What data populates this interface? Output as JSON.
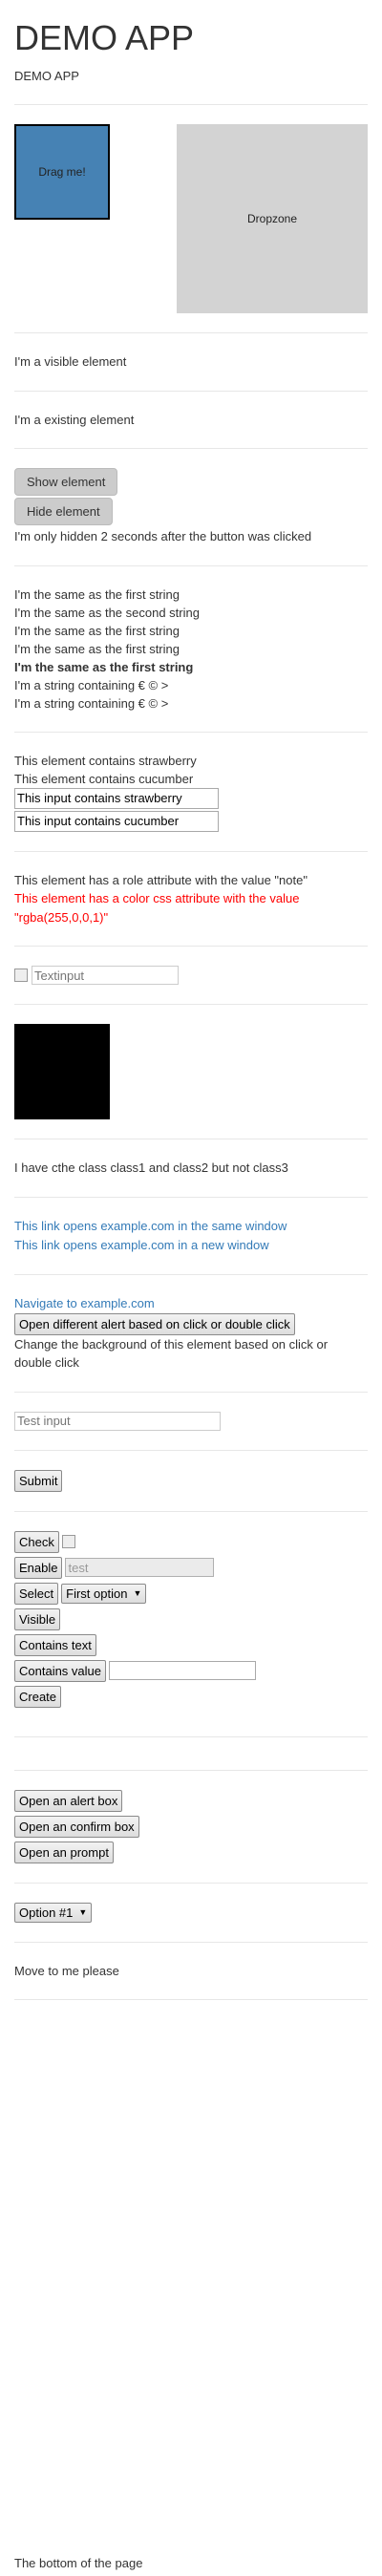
{
  "header": {
    "title": "DEMO APP",
    "subtitle": "DEMO APP"
  },
  "dnd": {
    "draggable_label": "Drag me!",
    "dropzone_label": "Dropzone"
  },
  "visibility": {
    "visible_text": "I'm a visible element",
    "existing_text": "I'm a existing element",
    "show_button": "Show element",
    "hide_button": "Hide element",
    "hidden_note": "I'm only hidden 2 seconds after the button was clicked"
  },
  "strings": [
    "I'm the same as the first string",
    "I'm the same as the second string",
    "I'm the same as the first string",
    "I'm the same as the first string",
    "I'm the same as the first string",
    "I'm a string containing € © >",
    "I'm a string containing € © >"
  ],
  "contains": {
    "strawberry_text": "This element contains strawberry",
    "cucumber_text": "This element contains cucumber",
    "strawberry_input": "This input contains strawberry",
    "cucumber_input": "This input contains cucumber"
  },
  "attributes": {
    "role_text": "This element has a role attribute with the value \"note\"",
    "color_text": "This element has a color css attribute with the value \"rgba(255,0,0,1)\""
  },
  "textinput": {
    "placeholder": "Textinput"
  },
  "classes": {
    "text": "I have cthe class class1 and class2 but not class3"
  },
  "links": {
    "same_window": "This link opens example.com in the same window",
    "new_window": "This link opens example.com in a new window"
  },
  "navigate": {
    "link": "Navigate to example.com",
    "alert_button": "Open different alert based on click or double click",
    "bg_text": "Change the background of this element based on click or double click"
  },
  "test_input": {
    "placeholder": "Test input"
  },
  "form": {
    "submit": "Submit"
  },
  "controls": {
    "check": "Check",
    "enable": "Enable",
    "enable_input_value": "test",
    "select": "Select",
    "select_value": "First option",
    "visible": "Visible",
    "contains_text": "Contains text",
    "contains_value": "Contains value",
    "create": "Create"
  },
  "dialogs": {
    "alert": "Open an alert box",
    "confirm": "Open an confirm box",
    "prompt": "Open an prompt"
  },
  "options": {
    "value": "Option #1"
  },
  "move": {
    "text": "Move to me please"
  },
  "bottom": {
    "text": "The bottom of the page"
  }
}
